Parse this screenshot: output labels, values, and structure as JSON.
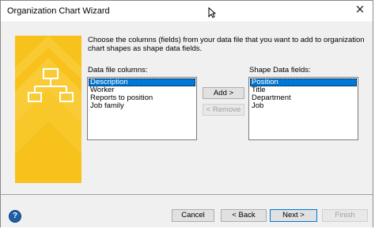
{
  "window": {
    "title": "Organization Chart Wizard",
    "close_glyph": "✕"
  },
  "instructions": "Choose the columns (fields) from your data file that you want to add to organization chart shapes as shape data fields.",
  "data_file_columns": {
    "label": "Data file columns:",
    "items": [
      "Description",
      "Worker",
      "Reports to position",
      "Job family"
    ],
    "selected": "Description"
  },
  "shape_data_fields": {
    "label": "Shape Data fields:",
    "items": [
      "Position",
      "Title",
      "Department",
      "Job"
    ],
    "selected": "Position"
  },
  "buttons": {
    "add": "Add >",
    "remove": "< Remove",
    "cancel": "Cancel",
    "back": "< Back",
    "next": "Next >",
    "finish": "Finish",
    "help": "?"
  },
  "colors": {
    "banner_yellow": "#f7c21b",
    "banner_light": "#fbd54f",
    "selection_blue": "#0078d7",
    "help_blue": "#1e5fa8"
  },
  "icons": {
    "close": "close-icon",
    "help": "help-icon",
    "org_chart": "org-chart-icon",
    "cursor": "mouse-cursor-icon"
  }
}
